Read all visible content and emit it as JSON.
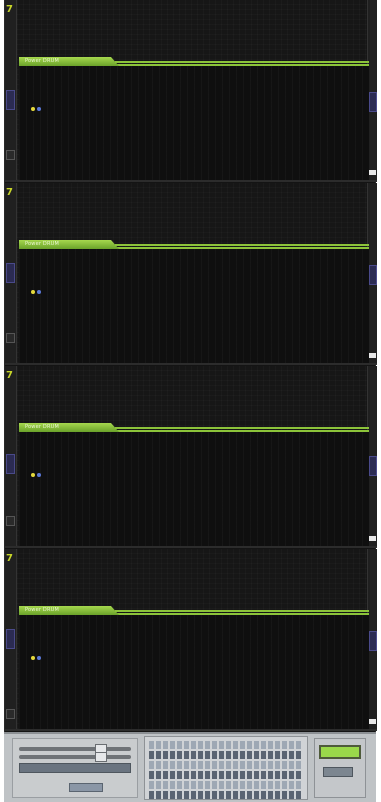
{
  "panels": [
    {
      "id": 1,
      "tab_label": "Power DRUM"
    },
    {
      "id": 2,
      "tab_label": "Power DRUM"
    },
    {
      "id": 3,
      "tab_label": "Power DRUM"
    },
    {
      "id": 4,
      "tab_label": "Power DRUM"
    }
  ],
  "colors": {
    "rack_background": "#141414",
    "accent_green": "#8cc43a",
    "indicator_yellow": "#e4d83c",
    "indicator_blue": "#5a78d8",
    "side_tab_purple": "#2b2b52",
    "transport_gray": "#bfc3c6",
    "lcd_green": "#9ad84a"
  },
  "icons": {
    "corner_mark": "corner-logo-icon"
  },
  "corner_mark_glyph": "7"
}
